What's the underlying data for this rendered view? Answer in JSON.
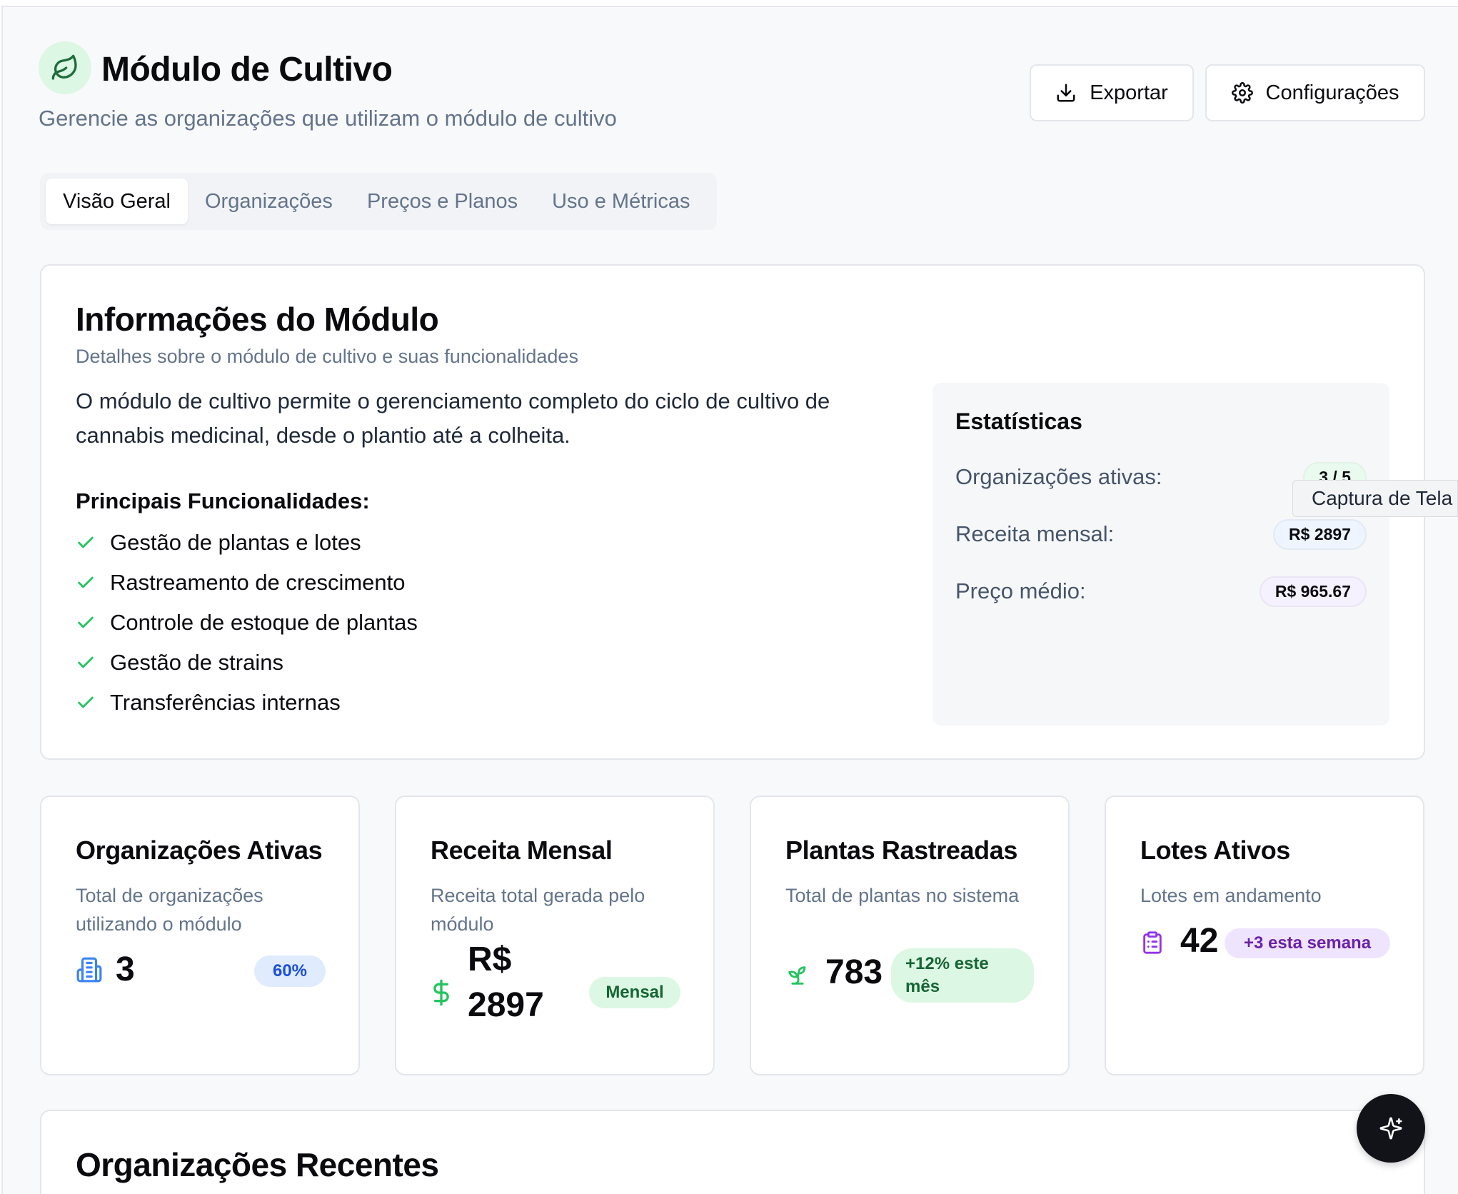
{
  "header": {
    "title": "Módulo de Cultivo",
    "subtitle": "Gerencie as organizações que utilizam o módulo de cultivo",
    "logo_icon": "leaf-icon",
    "export_label": "Exportar",
    "config_label": "Configurações"
  },
  "tabs": [
    {
      "label": "Visão Geral",
      "active": true
    },
    {
      "label": "Organizações",
      "active": false
    },
    {
      "label": "Preços e Planos",
      "active": false
    },
    {
      "label": "Uso e Métricas",
      "active": false
    }
  ],
  "module_info": {
    "title": "Informações do Módulo",
    "description": "Detalhes sobre o módulo de cultivo e suas funcionalidades",
    "body": "O módulo de cultivo permite o gerenciamento completo do ciclo de cultivo de cannabis medicinal, desde o plantio até a colheita.",
    "features_title": "Principais Funcionalidades:",
    "features": [
      "Gestão de plantas e lotes",
      "Rastreamento de crescimento",
      "Controle de estoque de plantas",
      "Gestão de strains",
      "Transferências internas"
    ],
    "stats": {
      "title": "Estatísticas",
      "rows": [
        {
          "label": "Organizações ativas:",
          "value": "3 / 5"
        },
        {
          "label": "Receita mensal:",
          "value": "R$ 2897"
        },
        {
          "label": "Preço médio:",
          "value": "R$ 965.67"
        }
      ]
    }
  },
  "tooltip": "Captura de Tela",
  "metrics": [
    {
      "title": "Organizações Ativas",
      "description": "Total de organizações utilizando o módulo",
      "value": "3",
      "badge": "60%",
      "icon": "building-icon",
      "color": "#3b82f6"
    },
    {
      "title": "Receita Mensal",
      "description": "Receita total gerada pelo módulo",
      "value_line1": "R$",
      "value_line2": "2897",
      "badge": "Mensal",
      "icon": "dollar-icon",
      "color": "#22c55e"
    },
    {
      "title": "Plantas Rastreadas",
      "description": "Total de plantas no sistema",
      "value": "783",
      "badge_line1": "+12% este",
      "badge_line2": "mês",
      "icon": "sprout-icon",
      "color": "#22c55e"
    },
    {
      "title": "Lotes Ativos",
      "description": "Lotes em andamento",
      "value": "42",
      "badge": "+3 esta semana",
      "icon": "clipboard-icon",
      "color": "#9333ea"
    }
  ],
  "recent": {
    "title": "Organizações Recentes"
  },
  "fab_icon": "sparkles-icon"
}
